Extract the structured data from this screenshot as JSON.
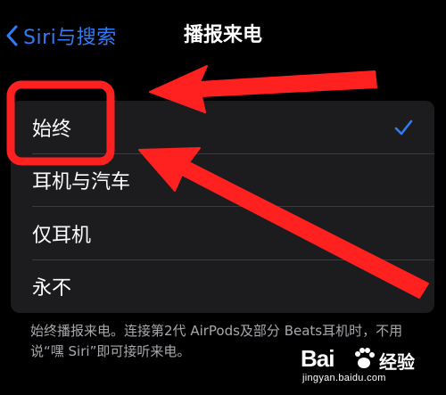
{
  "nav": {
    "back_label": "Siri与搜索",
    "title": "播报来电"
  },
  "options": [
    {
      "label": "始终",
      "selected": true
    },
    {
      "label": "耳机与汽车",
      "selected": false
    },
    {
      "label": "仅耳机",
      "selected": false
    },
    {
      "label": "永不",
      "selected": false
    }
  ],
  "footnote": "始终播报来电。连接第2代 AirPods及部分 Beats耳机时，不用说“嘿 Siri”即可接听来电。",
  "watermark": {
    "brand": "Bai",
    "suffix": "经验",
    "site": "jingyan.baidu.com"
  },
  "colors": {
    "accent": "#2f7cf6",
    "annotation": "#ff2020",
    "list_background": "#1c1c1e"
  },
  "icons": {
    "back": "chevron-left-icon",
    "selected": "checkmark-icon",
    "annotation": "red-arrow-icon"
  }
}
